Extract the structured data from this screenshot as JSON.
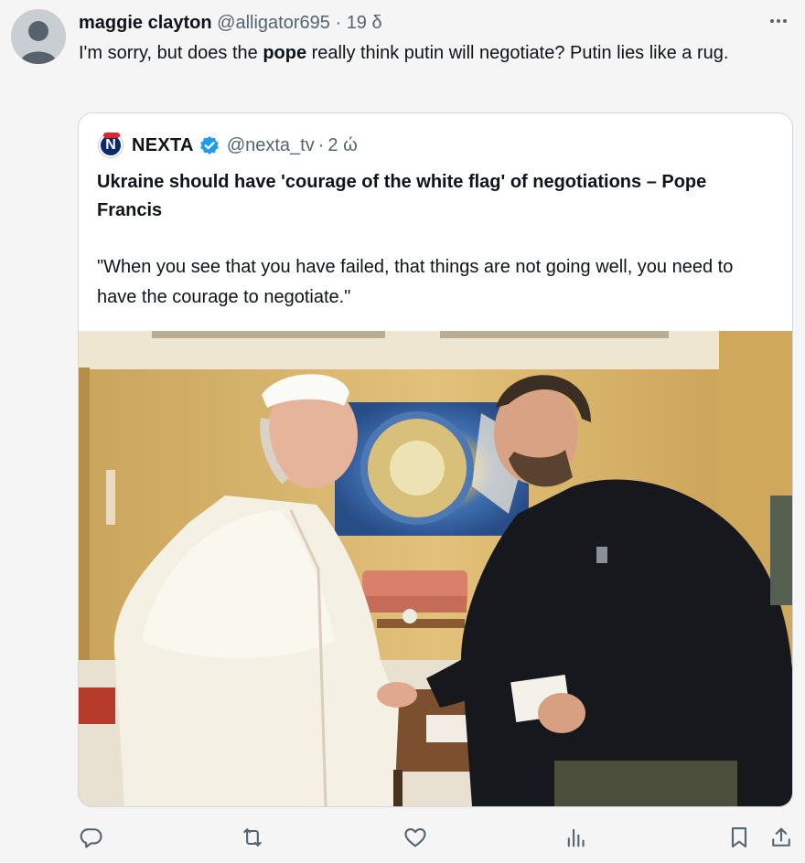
{
  "tweet": {
    "author_name": "maggie clayton",
    "handle": "@alligator695",
    "separator": "·",
    "time": "19 δ",
    "text_before": "I'm sorry, but does the ",
    "text_bold": "pope",
    "text_after": " really think putin will negotiate?  Putin lies like a rug.",
    "more_icon": "more-horizontal-icon"
  },
  "quote": {
    "logo_letter": "N",
    "author_name": "NEXTA",
    "handle": "@nexta_tv",
    "separator": "·",
    "time": "2 ώ",
    "headline": "Ukraine should have 'courage of the white flag' of negotiations – Pope Francis",
    "body": "\"When you see that you have failed, that things are not going well, you need to have the courage to negotiate.\"",
    "verified_color": "#1d9bf0"
  },
  "actions": [
    {
      "name": "reply-icon"
    },
    {
      "name": "retweet-icon"
    },
    {
      "name": "like-icon"
    },
    {
      "name": "views-icon"
    },
    {
      "name": "bookmark-icon"
    },
    {
      "name": "share-icon"
    }
  ],
  "colors": {
    "text": "#0f1419",
    "muted": "#536471",
    "border": "#cfd9de",
    "background": "#f5f5f5"
  }
}
